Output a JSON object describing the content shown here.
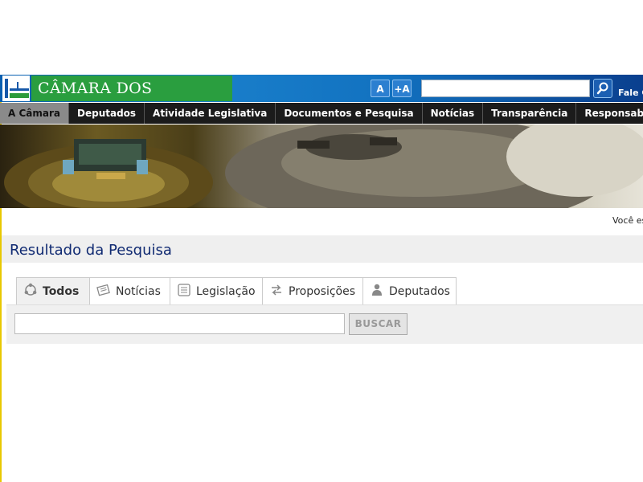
{
  "header": {
    "logo_text": "CÂMARA DOS DEPUTADOS",
    "font_small": "A",
    "font_large": "+A",
    "search_value": "",
    "contact_label": "Fale C"
  },
  "nav": {
    "items": [
      "A Câmara",
      "Deputados",
      "Atividade Legislativa",
      "Documentos e Pesquisa",
      "Notícias",
      "Transparência",
      "Responsabilidade Soci"
    ]
  },
  "breadcrumb": {
    "label": "Você es"
  },
  "page": {
    "title": "Resultado da Pesquisa"
  },
  "tabs": [
    {
      "label": "Todos",
      "icon": "all-icon"
    },
    {
      "label": "Notícias",
      "icon": "news-icon"
    },
    {
      "label": "Legislação",
      "icon": "legislation-icon"
    },
    {
      "label": "Proposições",
      "icon": "proposals-icon"
    },
    {
      "label": "Deputados",
      "icon": "deputies-icon"
    }
  ],
  "search": {
    "value": "",
    "button_label": "BUSCAR"
  },
  "colors": {
    "header_blue": "#1272c0",
    "logo_green": "#2a9e3f",
    "nav_bg": "#1b1b1b",
    "title_color": "#102a72"
  }
}
